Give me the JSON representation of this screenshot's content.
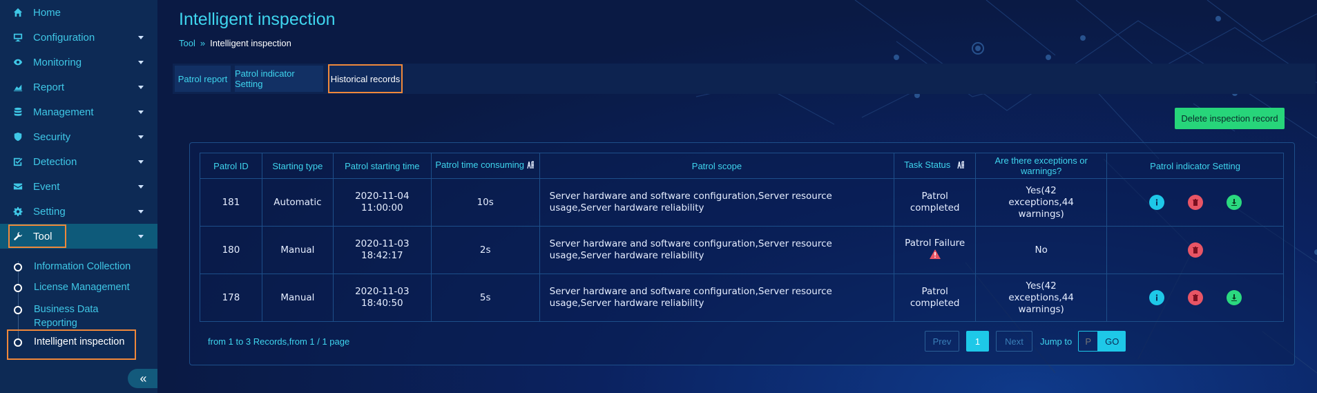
{
  "sidebar": {
    "items": [
      {
        "label": "Home",
        "icon": "home-icon"
      },
      {
        "label": "Configuration",
        "icon": "monitor-icon"
      },
      {
        "label": "Monitoring",
        "icon": "eye-icon"
      },
      {
        "label": "Report",
        "icon": "chart-icon"
      },
      {
        "label": "Management",
        "icon": "database-icon"
      },
      {
        "label": "Security",
        "icon": "shield-icon"
      },
      {
        "label": "Detection",
        "icon": "checkbox-icon"
      },
      {
        "label": "Event",
        "icon": "envelope-icon"
      },
      {
        "label": "Setting",
        "icon": "gear-icon"
      },
      {
        "label": "Tool",
        "icon": "wrench-icon"
      }
    ],
    "sub_items": [
      {
        "label": "Information Collection"
      },
      {
        "label": "License Management"
      },
      {
        "label": "Business Data Reporting"
      },
      {
        "label": "Intelligent inspection"
      }
    ],
    "collapse_label": "«"
  },
  "header": {
    "title": "Intelligent inspection",
    "breadcrumb": {
      "parent": "Tool",
      "separator": "»",
      "current": "Intelligent inspection"
    }
  },
  "tabs": [
    {
      "label": "Patrol report"
    },
    {
      "label": "Patrol indicator Setting"
    },
    {
      "label": "Historical records"
    }
  ],
  "toolbar": {
    "delete_label": "Delete inspection record"
  },
  "table": {
    "headers": [
      "Patrol ID",
      "Starting type",
      "Patrol starting time",
      "Patrol time consuming",
      "Patrol scope",
      "Task Status",
      "Are there exceptions or warnings?",
      "Patrol indicator Setting"
    ],
    "rows": [
      {
        "id": "181",
        "type": "Automatic",
        "date": "2020-11-04",
        "time": "11:00:00",
        "duration": "10s",
        "scope": "Server hardware and software configuration,Server resource usage,Server hardware reliability",
        "status": "Patrol completed",
        "exceptions": "Yes(42 exceptions,44 warnings)",
        "actions": [
          "info",
          "delete",
          "download"
        ]
      },
      {
        "id": "180",
        "type": "Manual",
        "date": "2020-11-03",
        "time": "18:42:17",
        "duration": "2s",
        "scope": "Server hardware and software configuration,Server resource usage,Server hardware reliability",
        "status": "Patrol Failure",
        "exceptions": "No",
        "actions": [
          "delete"
        ]
      },
      {
        "id": "178",
        "type": "Manual",
        "date": "2020-11-03",
        "time": "18:40:50",
        "duration": "5s",
        "scope": "Server hardware and software configuration,Server resource usage,Server hardware reliability",
        "status": "Patrol completed",
        "exceptions": "Yes(42 exceptions,44 warnings)",
        "actions": [
          "info",
          "delete",
          "download"
        ]
      }
    ]
  },
  "footer": {
    "records_text": "from 1 to 3 Records,from 1 / 1 page",
    "prev": "Prev",
    "page": "1",
    "next": "Next",
    "jump_label": "Jump to",
    "jump_placeholder": "P",
    "go": "GO"
  },
  "colors": {
    "accent": "#3fd5ee",
    "highlight_box": "#f0883a",
    "delete_button": "#27d57a",
    "danger": "#e85565"
  }
}
